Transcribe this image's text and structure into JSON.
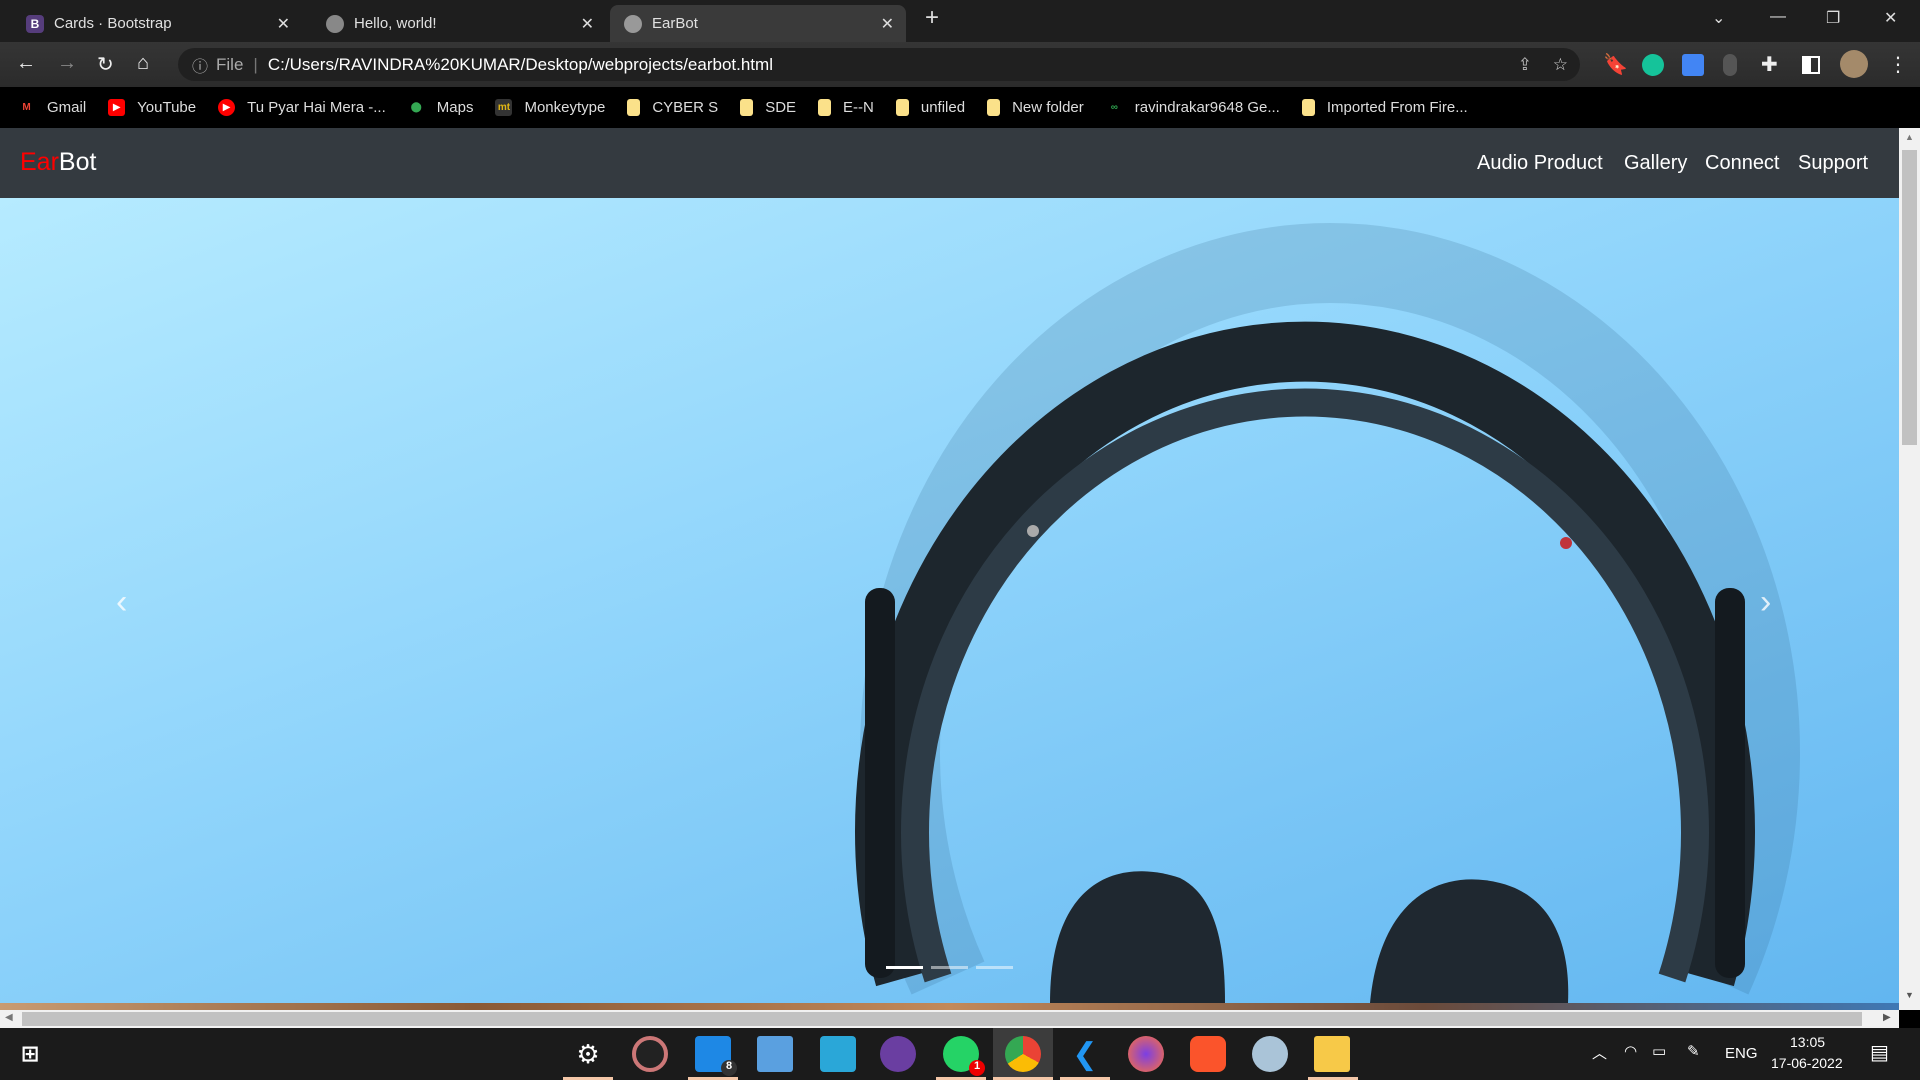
{
  "browser": {
    "tabs": [
      {
        "title": "Cards · Bootstrap",
        "icon": "bootstrap-icon",
        "active": false
      },
      {
        "title": "Hello, world!",
        "icon": "globe-icon",
        "active": false
      },
      {
        "title": "EarBot",
        "icon": "globe-icon",
        "active": true
      }
    ],
    "address": {
      "scheme_label": "File",
      "url": "C:/Users/RAVINDRA%20KUMAR/Desktop/webprojects/earbot.html"
    },
    "bookmarks": [
      "Gmail",
      "YouTube",
      "Tu Pyar Hai Mera -...",
      "Maps",
      "Monkeytype",
      "CYBER S",
      "SDE",
      "E--N",
      "unfiled",
      "New folder",
      "ravindrakar9648 Ge...",
      "Imported From Fire..."
    ]
  },
  "page": {
    "brand": {
      "accent": "Ear",
      "rest": "Bot",
      "accent_color": "#ff0000"
    },
    "nav": [
      "Audio Product",
      "Gallery",
      "Connect",
      "Support"
    ],
    "carousel": {
      "slides": 3,
      "active_slide": 1,
      "prev_label": "‹",
      "next_label": "›"
    }
  },
  "taskbar": {
    "badges": {
      "mail": "8",
      "whatsapp": "1"
    },
    "language": "ENG",
    "time": "13:05",
    "date": "17-06-2022"
  }
}
